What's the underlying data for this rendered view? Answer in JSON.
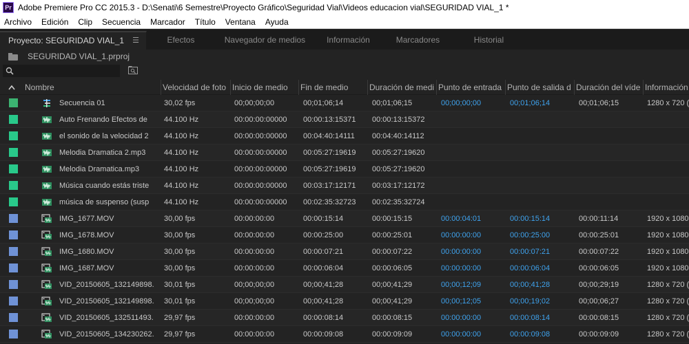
{
  "window": {
    "title": "Adobe Premiere Pro CC 2015.3 - D:\\Senati\\6 Semestre\\Proyecto Gráfico\\Seguridad Vial\\Videos educacion vial\\SEGURIDAD VIAL_1 *",
    "app_icon_text": "Pr"
  },
  "menu": [
    "Archivo",
    "Edición",
    "Clip",
    "Secuencia",
    "Marcador",
    "Título",
    "Ventana",
    "Ayuda"
  ],
  "tabs": [
    {
      "label": "Proyecto: SEGURIDAD VIAL_1",
      "active": true
    },
    {
      "label": "Efectos",
      "active": false
    },
    {
      "label": "Navegador de medios",
      "active": false
    },
    {
      "label": "Información",
      "active": false
    },
    {
      "label": "Marcadores",
      "active": false
    },
    {
      "label": "Historial",
      "active": false
    }
  ],
  "project": {
    "file": "SEGURIDAD VIAL_1.prproj"
  },
  "search": {
    "value": "",
    "placeholder": ""
  },
  "columns": [
    "Nombre",
    "Velocidad de foto",
    "Inicio de medio",
    "Fin de medio",
    "Duración de medi",
    "Punto de entrada",
    "Punto de salida d",
    "Duración del víde",
    "Información"
  ],
  "colors": {
    "label_sequence": "#3cb371",
    "label_audio": "#29c98a",
    "label_video": "#6f92d6",
    "timecode_blue": "#3fa3ee"
  },
  "rows": [
    {
      "type": "sequence-icon",
      "label": "sequence",
      "name": "Secuencia 01",
      "fps": "30,02 fps",
      "start": "00;00;00;00",
      "end": "00;01;06;14",
      "dur": "00;01;06;15",
      "in": "00;00;00;00",
      "out": "00;01;06;14",
      "vdur": "00;01;06;15",
      "info": "1280 x 720 ("
    },
    {
      "type": "audio-clip-icon",
      "label": "audio",
      "name": "Auto Frenando   Efectos de",
      "fps": "44.100 Hz",
      "start": "00:00:00:00000",
      "end": "00:00:13:15371",
      "dur": "00:00:13:15372",
      "in": "",
      "out": "",
      "vdur": "",
      "info": ""
    },
    {
      "type": "audio-clip-icon",
      "label": "audio",
      "name": "el sonido de la velocidad 2",
      "fps": "44.100 Hz",
      "start": "00:00:00:00000",
      "end": "00:04:40:14111",
      "dur": "00:04:40:14112",
      "in": "",
      "out": "",
      "vdur": "",
      "info": ""
    },
    {
      "type": "audio-clip-icon",
      "label": "audio",
      "name": "Melodia Dramatica 2.mp3",
      "fps": "44.100 Hz",
      "start": "00:00:00:00000",
      "end": "00:05:27:19619",
      "dur": "00:05:27:19620",
      "in": "",
      "out": "",
      "vdur": "",
      "info": ""
    },
    {
      "type": "audio-clip-icon",
      "label": "audio",
      "name": "Melodia Dramatica.mp3",
      "fps": "44.100 Hz",
      "start": "00:00:00:00000",
      "end": "00:05:27:19619",
      "dur": "00:05:27:19620",
      "in": "",
      "out": "",
      "vdur": "",
      "info": ""
    },
    {
      "type": "audio-clip-icon",
      "label": "audio",
      "name": "Música cuando estás triste",
      "fps": "44.100 Hz",
      "start": "00:00:00:00000",
      "end": "00:03:17:12171",
      "dur": "00:03:17:12172",
      "in": "",
      "out": "",
      "vdur": "",
      "info": ""
    },
    {
      "type": "audio-clip-icon",
      "label": "audio",
      "name": "música de suspenso (susp",
      "fps": "44.100 Hz",
      "start": "00:00:00:00000",
      "end": "00:02:35:32723",
      "dur": "00:02:35:32724",
      "in": "",
      "out": "",
      "vdur": "",
      "info": ""
    },
    {
      "type": "video-clip-icon",
      "label": "video",
      "name": "IMG_1677.MOV",
      "fps": "30,00 fps",
      "start": "00:00:00:00",
      "end": "00:00:15:14",
      "dur": "00:00:15:15",
      "in": "00:00:04:01",
      "out": "00:00:15:14",
      "vdur": "00:00:11:14",
      "info": "1920 x 1080"
    },
    {
      "type": "video-clip-icon",
      "label": "video",
      "name": "IMG_1678.MOV",
      "fps": "30,00 fps",
      "start": "00:00:00:00",
      "end": "00:00:25:00",
      "dur": "00:00:25:01",
      "in": "00:00:00:00",
      "out": "00:00:25:00",
      "vdur": "00:00:25:01",
      "info": "1920 x 1080"
    },
    {
      "type": "video-clip-icon",
      "label": "video",
      "name": "IMG_1680.MOV",
      "fps": "30,00 fps",
      "start": "00:00:00:00",
      "end": "00:00:07:21",
      "dur": "00:00:07:22",
      "in": "00:00:00:00",
      "out": "00:00:07:21",
      "vdur": "00:00:07:22",
      "info": "1920 x 1080"
    },
    {
      "type": "video-clip-icon",
      "label": "video",
      "name": "IMG_1687.MOV",
      "fps": "30,00 fps",
      "start": "00:00:00:00",
      "end": "00:00:06:04",
      "dur": "00:00:06:05",
      "in": "00:00:00:00",
      "out": "00:00:06:04",
      "vdur": "00:00:06:05",
      "info": "1920 x 1080"
    },
    {
      "type": "video-clip-icon",
      "label": "video",
      "name": "VID_20150605_132149898.",
      "fps": "30,01 fps",
      "start": "00;00;00;00",
      "end": "00;00;41;28",
      "dur": "00;00;41;29",
      "in": "00;00;12;09",
      "out": "00;00;41;28",
      "vdur": "00;00;29;19",
      "info": "1280 x 720 ("
    },
    {
      "type": "video-clip-icon",
      "label": "video",
      "name": "VID_20150605_132149898.",
      "fps": "30,01 fps",
      "start": "00;00;00;00",
      "end": "00;00;41;28",
      "dur": "00;00;41;29",
      "in": "00;00;12;05",
      "out": "00;00;19;02",
      "vdur": "00;00;06;27",
      "info": "1280 x 720 ("
    },
    {
      "type": "video-clip-icon",
      "label": "video",
      "name": "VID_20150605_132511493.",
      "fps": "29,97 fps",
      "start": "00:00:00:00",
      "end": "00:00:08:14",
      "dur": "00:00:08:15",
      "in": "00:00:00:00",
      "out": "00:00:08:14",
      "vdur": "00:00:08:15",
      "info": "1280 x 720 ("
    },
    {
      "type": "video-clip-icon",
      "label": "video",
      "name": "VID_20150605_134230262.",
      "fps": "29,97 fps",
      "start": "00:00:00:00",
      "end": "00:00:09:08",
      "dur": "00:00:09:09",
      "in": "00:00:00:00",
      "out": "00:00:09:08",
      "vdur": "00:00:09:09",
      "info": "1280 x 720 ("
    }
  ]
}
